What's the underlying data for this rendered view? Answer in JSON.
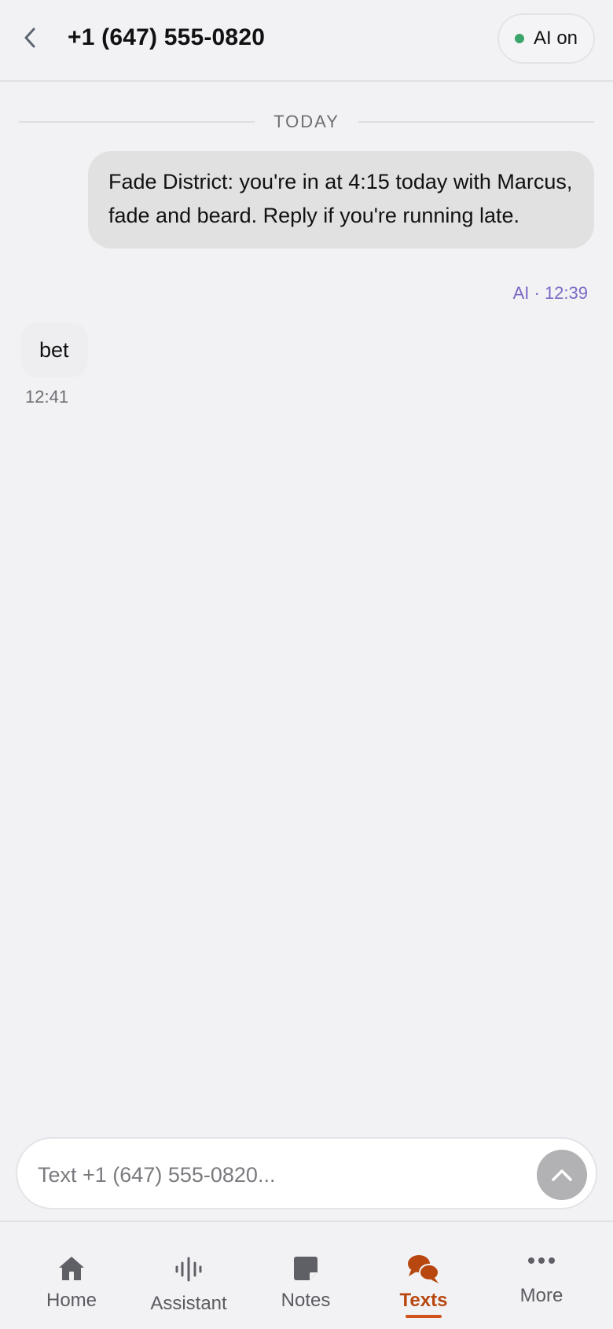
{
  "header": {
    "title": "+1 (647) 555-0820",
    "ai_status_label": "AI on",
    "ai_status_color": "#3aa56a"
  },
  "thread": {
    "date_divider": "TODAY",
    "messages": [
      {
        "direction": "outgoing",
        "text": "Fade District: you're in at 4:15 today with Marcus, fade and beard. Reply if you're running late.",
        "meta": "AI · 12:39"
      },
      {
        "direction": "incoming",
        "text": "bet",
        "meta": "12:41"
      }
    ]
  },
  "composer": {
    "placeholder": "Text +1 (647) 555-0820..."
  },
  "tabbar": {
    "items": [
      {
        "label": "Home",
        "icon": "home-icon",
        "active": false
      },
      {
        "label": "Assistant",
        "icon": "waveform-icon",
        "active": false
      },
      {
        "label": "Notes",
        "icon": "note-icon",
        "active": false
      },
      {
        "label": "Texts",
        "icon": "chat-bubbles-icon",
        "active": true
      },
      {
        "label": "More",
        "icon": "more-dots-icon",
        "active": false
      }
    ],
    "accent_color": "#b8470f"
  }
}
